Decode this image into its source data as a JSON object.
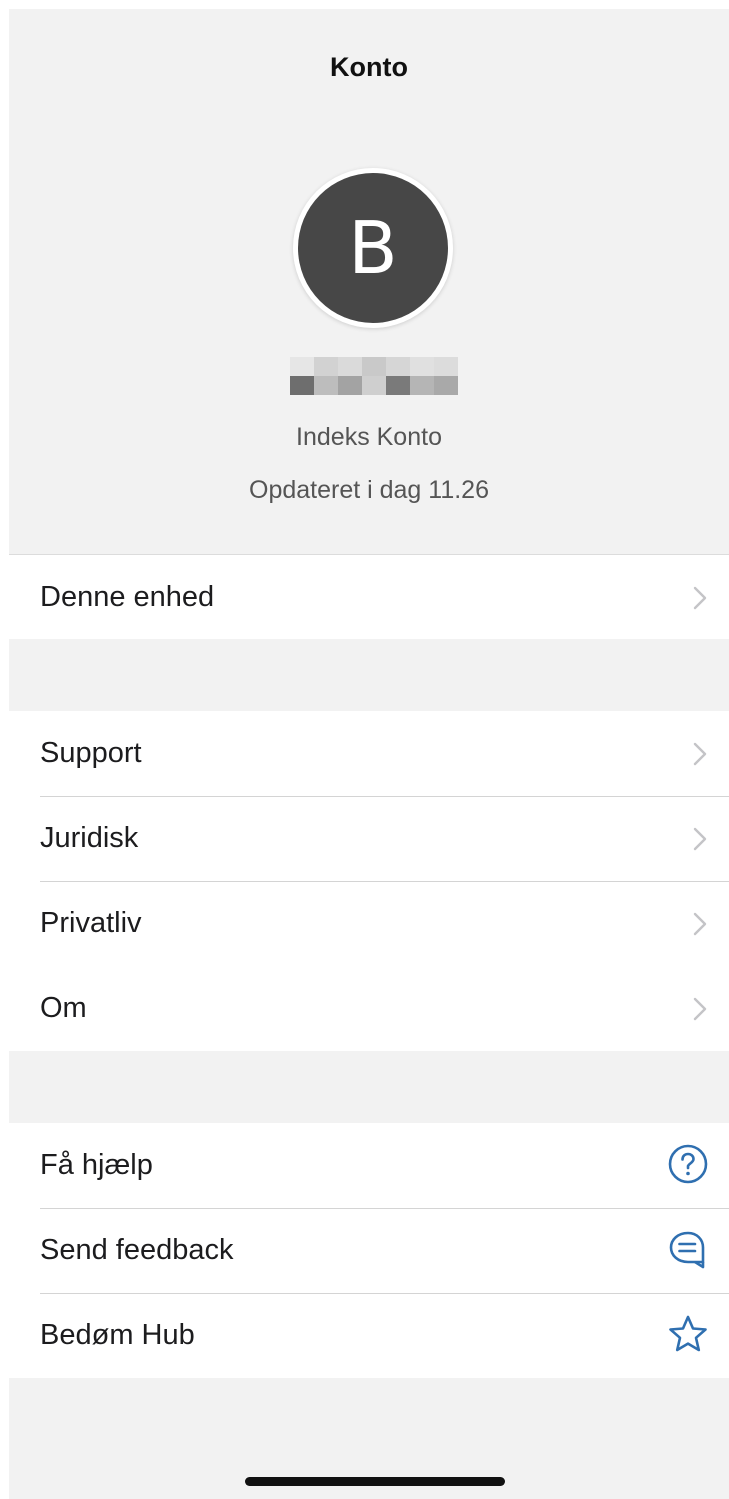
{
  "nav": {
    "title": "Konto"
  },
  "profile": {
    "avatar_initial": "B",
    "account_type": "Indeks Konto",
    "updated": "Opdateret i dag 11.26"
  },
  "group1": {
    "rows": [
      {
        "label": "Denne enhed"
      }
    ]
  },
  "group2": {
    "rows": [
      {
        "label": "Support"
      },
      {
        "label": "Juridisk"
      },
      {
        "label": "Privatliv"
      },
      {
        "label": "Om"
      }
    ]
  },
  "group3": {
    "rows": [
      {
        "label": "Få hjælp",
        "icon": "help-circle-icon"
      },
      {
        "label": "Send feedback",
        "icon": "chat-bubble-icon"
      },
      {
        "label": "Bedøm Hub",
        "icon": "star-icon"
      }
    ]
  },
  "colors": {
    "accent": "#2f6fb0",
    "avatar_bg": "#474747",
    "chevron": "#c4c4c7",
    "background": "#f2f2f2"
  }
}
